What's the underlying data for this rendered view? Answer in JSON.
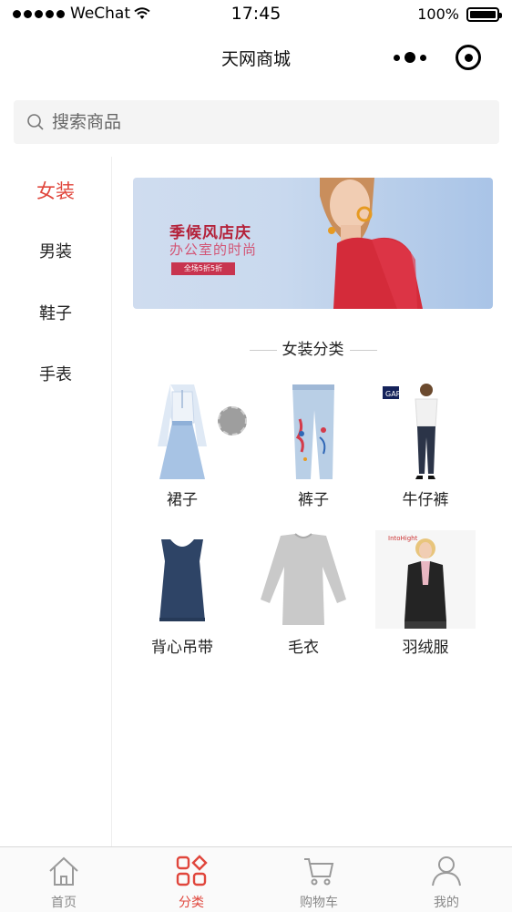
{
  "status_bar": {
    "carrier": "WeChat",
    "time": "17:45",
    "battery": "100%"
  },
  "nav": {
    "title": "天网商城",
    "more_icon": "more-dots-icon",
    "close_icon": "target-close-icon"
  },
  "search": {
    "placeholder": "搜索商品",
    "icon": "search-icon"
  },
  "sidebar": {
    "items": [
      {
        "label": "女装",
        "active": true
      },
      {
        "label": "男装",
        "active": false
      },
      {
        "label": "鞋子",
        "active": false
      },
      {
        "label": "手表",
        "active": false
      }
    ]
  },
  "banner": {
    "title": "季候风店庆",
    "subtitle": "办公室的时尚",
    "tag": "全场5折5折"
  },
  "section": {
    "title": "女装分类"
  },
  "categories": [
    {
      "label": "裙子",
      "icon": "dress-icon"
    },
    {
      "label": "裤子",
      "icon": "jeans-icon"
    },
    {
      "label": "牛仔裤",
      "icon": "model-jeans-icon"
    },
    {
      "label": "背心吊带",
      "icon": "tank-top-icon"
    },
    {
      "label": "毛衣",
      "icon": "sweater-icon"
    },
    {
      "label": "羽绒服",
      "icon": "down-jacket-icon"
    }
  ],
  "tabbar": {
    "items": [
      {
        "label": "首页",
        "icon": "home-icon",
        "active": false
      },
      {
        "label": "分类",
        "icon": "category-icon",
        "active": true
      },
      {
        "label": "购物车",
        "icon": "cart-icon",
        "active": false
      },
      {
        "label": "我的",
        "icon": "user-icon",
        "active": false
      }
    ]
  },
  "colors": {
    "accent": "#e0463c",
    "text": "#222222",
    "muted": "#888888"
  }
}
